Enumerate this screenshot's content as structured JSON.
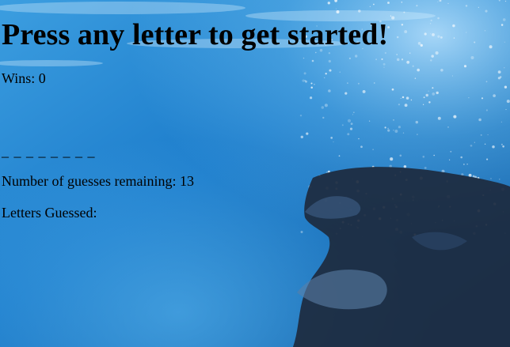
{
  "game": {
    "prompt": "Press any letter to get started!",
    "wins_label": "Wins:",
    "wins_value": "0",
    "current_word": "_ _ _ _ _ _ _ _",
    "remaining_label": "Number of guesses remaining:",
    "remaining_value": "13",
    "letters_guessed_label": "Letters Guessed:",
    "letters_guessed_value": ""
  },
  "background": {
    "scene": "underwater-whale-shark",
    "colors": {
      "water_light": "#4fb0ee",
      "water_mid": "#1a78c4",
      "water_deep": "#0d4f93",
      "animal": "#1d2a3e"
    }
  }
}
